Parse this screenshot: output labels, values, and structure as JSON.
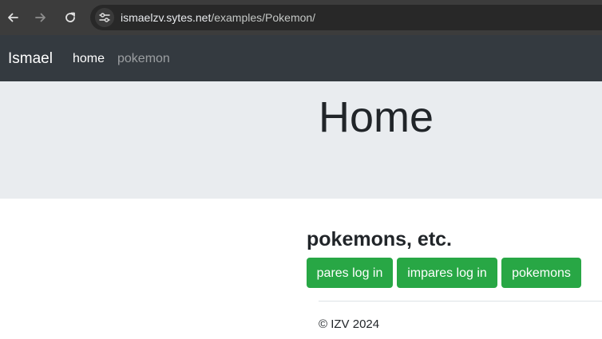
{
  "browser": {
    "url_host": "ismaelzv.sytes.net",
    "url_path": "/examples/Pokemon/",
    "icons": {
      "back": "arrow-left-icon",
      "forward": "arrow-right-icon",
      "reload": "reload-icon",
      "site_info": "tune-icon"
    }
  },
  "navbar": {
    "brand": "Ismael",
    "links": [
      {
        "label": "home",
        "active": true
      },
      {
        "label": "pokemon",
        "active": false
      }
    ]
  },
  "jumbotron": {
    "title": "Home"
  },
  "main": {
    "heading": "pokemons, etc.",
    "buttons": [
      {
        "label": "pares log in"
      },
      {
        "label": "impares log in"
      },
      {
        "label": "pokemons"
      }
    ]
  },
  "footer": {
    "text": "© IZV 2024"
  },
  "colors": {
    "browser_bar": "#3c3c3c",
    "navbar_bg": "#343a40",
    "jumbotron_bg": "#e9ecef",
    "button_green": "#28a745"
  }
}
